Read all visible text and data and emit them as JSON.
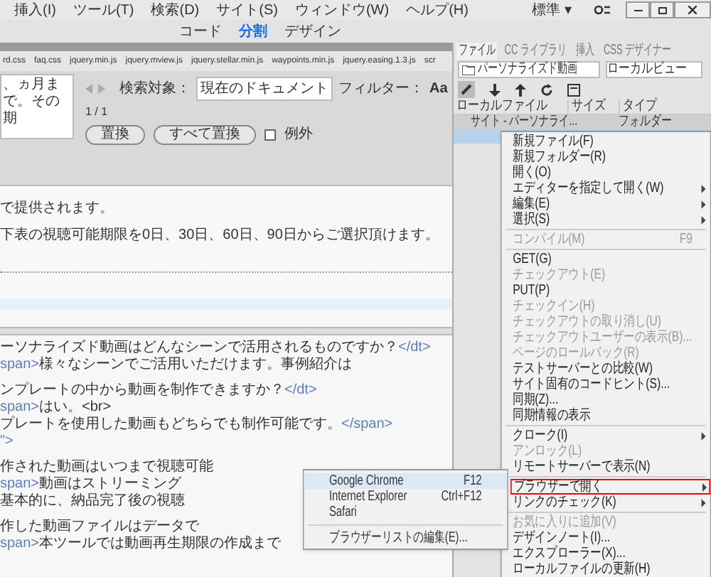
{
  "menu_bar": {
    "items": [
      "挿入(I)",
      "ツール(T)",
      "検索(D)",
      "サイト(S)",
      "ウィンドウ(W)",
      "ヘルプ(H)"
    ],
    "workspace": "標準 ▾"
  },
  "view_switcher": [
    {
      "label": "コード",
      "selected": false
    },
    {
      "label": "分割",
      "selected": true
    },
    {
      "label": "デザイン",
      "selected": false
    }
  ],
  "file_tabs": [
    "rd.css",
    "faq.css",
    "jquery.min.js",
    "jquery.mview.js",
    "jquery.stellar.min.js",
    "waypoints.min.js",
    "jquery.easing.1.3.js",
    "scr"
  ],
  "find_panel": {
    "search_text": "、ヵ月まで。その期",
    "scope_label": "検索対象：",
    "scope": "現在のドキュメント",
    "filter_label": "フィルター：",
    "match_case": "Aa",
    "count": "1 / 1",
    "buttons": [
      "置換",
      "すべて置換"
    ],
    "exception": {
      "label": "例外",
      "checked": false
    }
  },
  "design_view": {
    "lines": [
      "で提供されます。",
      "下表の視聴可能期限を0日、30日、60日、90日からご選択頂けます。"
    ]
  },
  "code_view": {
    "lines": [
      {
        "parts": [
          {
            "kind": "text",
            "text": "ーソナライズド動画はどんなシーンで活用されるものですか？"
          },
          {
            "kind": "tag",
            "text": "</dt>"
          }
        ]
      },
      {
        "parts": [
          {
            "kind": "tag",
            "text": "span>"
          },
          {
            "kind": "text",
            "text": "様々なシーンでご活用いただけます。事例紹介は"
          }
        ]
      },
      {
        "parts": [
          {
            "kind": "text",
            "text": "ンプレートの中から動画を制作できますか？"
          },
          {
            "kind": "tag",
            "text": "</dt>"
          }
        ]
      },
      {
        "parts": [
          {
            "kind": "tag",
            "text": "span>"
          },
          {
            "kind": "text",
            "text": "はい。<br>"
          }
        ]
      },
      {
        "parts": [
          {
            "kind": "text",
            "text": "プレートを使用した動画もどちらでも制作可能です。"
          },
          {
            "kind": "tag",
            "text": "</span>"
          }
        ]
      },
      {
        "parts": [
          {
            "kind": "tag",
            "text": "\">"
          }
        ]
      },
      {
        "parts": [
          {
            "kind": "text",
            "text": "作された動画はいつまで視聴可能"
          }
        ]
      },
      {
        "parts": [
          {
            "kind": "tag",
            "text": "span>"
          },
          {
            "kind": "text",
            "text": "動画はストリーミング"
          }
        ]
      },
      {
        "parts": [
          {
            "kind": "text",
            "text": "基本的に、納品完了後の視聴"
          }
        ]
      },
      {
        "parts": [
          {
            "kind": "text",
            "text": "作した動画ファイルはデータで"
          }
        ]
      },
      {
        "parts": [
          {
            "kind": "tag",
            "text": "span>"
          },
          {
            "kind": "text",
            "text": "本ツールでは動画再生期限の作成まで"
          }
        ]
      }
    ]
  },
  "files_panel": {
    "tabs": [
      {
        "label": "ファイル",
        "selected": true
      },
      {
        "label": "CC ライブラリ",
        "selected": false
      },
      {
        "label": "挿入",
        "selected": false
      },
      {
        "label": "CSS デザイナー",
        "selected": false
      }
    ],
    "site": "パーソナライズド動画",
    "view": "ローカルビュー",
    "columns": [
      "ローカルファイル",
      "サイズ",
      "タイプ"
    ],
    "rows": [
      {
        "name": "サイト - パーソナライ...",
        "type": "フォルダー"
      }
    ]
  },
  "context_menu": [
    {
      "kind": "item",
      "label": "新規ファイル(F)",
      "disabled": false,
      "submenu": false,
      "highlighted": false
    },
    {
      "kind": "item",
      "label": "新規フォルダー(R)",
      "disabled": false,
      "submenu": false,
      "highlighted": false
    },
    {
      "kind": "item",
      "label": "開く(O)",
      "disabled": false,
      "submenu": false,
      "highlighted": false
    },
    {
      "kind": "item",
      "label": "エディターを指定して開く(W)",
      "disabled": false,
      "submenu": true,
      "highlighted": false
    },
    {
      "kind": "item",
      "label": "編集(E)",
      "disabled": false,
      "submenu": true,
      "highlighted": false
    },
    {
      "kind": "item",
      "label": "選択(S)",
      "disabled": false,
      "submenu": true,
      "highlighted": false
    },
    {
      "kind": "separator"
    },
    {
      "kind": "item",
      "label": "コンパイル(M)",
      "shortcut": "F9",
      "disabled": true,
      "submenu": false,
      "highlighted": false
    },
    {
      "kind": "separator"
    },
    {
      "kind": "item",
      "label": "GET(G)",
      "disabled": false,
      "submenu": false,
      "highlighted": false
    },
    {
      "kind": "item",
      "label": "チェックアウト(E)",
      "disabled": true,
      "submenu": false,
      "highlighted": false
    },
    {
      "kind": "item",
      "label": "PUT(P)",
      "disabled": false,
      "submenu": false,
      "highlighted": false
    },
    {
      "kind": "item",
      "label": "チェックイン(H)",
      "disabled": true,
      "submenu": false,
      "highlighted": false
    },
    {
      "kind": "item",
      "label": "チェックアウトの取り消し(U)",
      "disabled": true,
      "submenu": false,
      "highlighted": false
    },
    {
      "kind": "item",
      "label": "チェックアウトユーザーの表示(B)...",
      "disabled": true,
      "submenu": false,
      "highlighted": false
    },
    {
      "kind": "item",
      "label": "ページのロールバック(R)",
      "disabled": true,
      "submenu": false,
      "highlighted": false
    },
    {
      "kind": "item",
      "label": "テストサーバーとの比較(W)",
      "disabled": false,
      "submenu": false,
      "highlighted": false
    },
    {
      "kind": "item",
      "label": "サイト固有のコードヒント(S)...",
      "disabled": false,
      "submenu": false,
      "highlighted": false
    },
    {
      "kind": "item",
      "label": "同期(Z)...",
      "disabled": false,
      "submenu": false,
      "highlighted": false
    },
    {
      "kind": "item",
      "label": "同期情報の表示",
      "disabled": false,
      "submenu": false,
      "highlighted": false
    },
    {
      "kind": "separator"
    },
    {
      "kind": "item",
      "label": "クローク(I)",
      "disabled": false,
      "submenu": true,
      "highlighted": false
    },
    {
      "kind": "item",
      "label": "アンロック(L)",
      "disabled": true,
      "submenu": false,
      "highlighted": false
    },
    {
      "kind": "item",
      "label": "リモートサーバーで表示(N)",
      "disabled": false,
      "submenu": false,
      "highlighted": false
    },
    {
      "kind": "separator"
    },
    {
      "kind": "item",
      "label": "ブラウザーで開く",
      "disabled": false,
      "submenu": true,
      "highlighted": true
    },
    {
      "kind": "item",
      "label": "リンクのチェック(K)",
      "disabled": false,
      "submenu": true,
      "highlighted": false
    },
    {
      "kind": "separator"
    },
    {
      "kind": "item",
      "label": "お気に入りに追加(V)",
      "disabled": true,
      "submenu": false,
      "highlighted": false
    },
    {
      "kind": "item",
      "label": "デザインノート(I)...",
      "disabled": false,
      "submenu": false,
      "highlighted": false
    },
    {
      "kind": "item",
      "label": "エクスプローラー(X)...",
      "disabled": false,
      "submenu": false,
      "highlighted": false
    },
    {
      "kind": "item",
      "label": "ローカルファイルの更新(H)",
      "disabled": false,
      "submenu": false,
      "highlighted": false
    }
  ],
  "browser_submenu": [
    {
      "kind": "item",
      "label": "Google Chrome",
      "shortcut": "F12",
      "selected": true
    },
    {
      "kind": "item",
      "label": "Internet Explorer",
      "shortcut": "Ctrl+F12",
      "selected": false
    },
    {
      "kind": "item",
      "label": "Safari",
      "selected": false
    },
    {
      "kind": "separator"
    },
    {
      "kind": "item",
      "label": "ブラウザーリストの編集(E)...",
      "selected": false
    }
  ]
}
